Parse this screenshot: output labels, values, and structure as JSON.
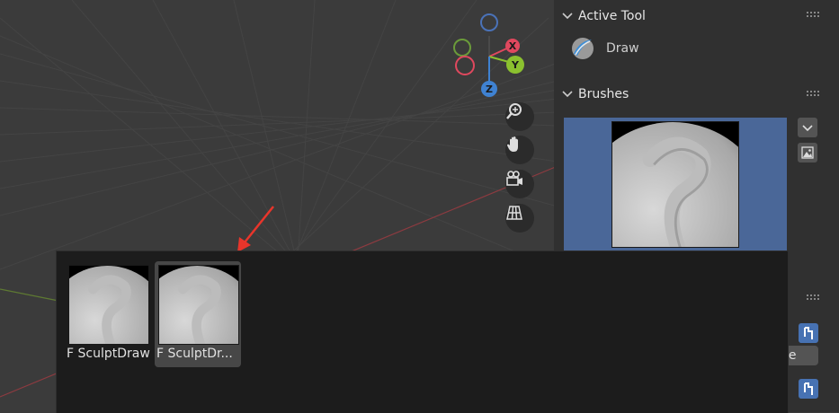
{
  "gizmo": {
    "x_label": "X",
    "y_label": "Y",
    "z_label": "Z"
  },
  "side_panel": {
    "active_tool": {
      "header": "Active Tool",
      "tool_name": "Draw",
      "tool_icon": "sculpt-draw-icon"
    },
    "brushes": {
      "header": "Brushes",
      "preview_icon": "brush-sphere-thumbnail"
    },
    "partial_field_text": "ne"
  },
  "brush_popup": {
    "items": [
      {
        "label": "F SculptDraw",
        "selected": false
      },
      {
        "label": "F SculptDr...",
        "selected": true
      }
    ]
  },
  "colors": {
    "viewport_bg": "#3b3b3b",
    "axis_x": "#e0485e",
    "axis_y": "#8bc12f",
    "axis_z": "#3f82d2",
    "selection_blue": "#4a6798",
    "arrow_red": "#e8352b"
  }
}
